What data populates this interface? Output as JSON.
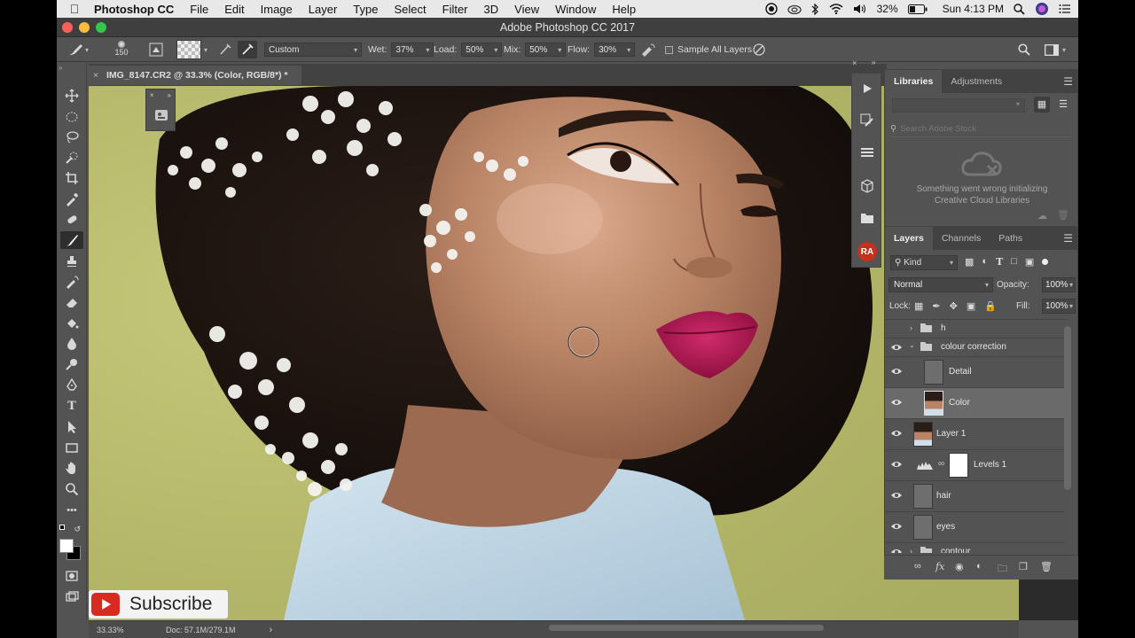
{
  "menubar": {
    "app_name": "Photoshop CC",
    "items": [
      "File",
      "Edit",
      "Image",
      "Layer",
      "Type",
      "Select",
      "Filter",
      "3D",
      "View",
      "Window",
      "Help"
    ],
    "battery": "32%",
    "clock": "Sun 4:13 PM"
  },
  "window_title": "Adobe Photoshop CC 2017",
  "options": {
    "brush_size": "150",
    "preset": "Custom",
    "wet_label": "Wet:",
    "wet_value": "37%",
    "load_label": "Load:",
    "load_value": "50%",
    "mix_label": "Mix:",
    "mix_value": "50%",
    "flow_label": "Flow:",
    "flow_value": "30%",
    "sample_all_layers": "Sample All Layers"
  },
  "document": {
    "tab_title": "IMG_8147.CR2 @ 33.3% (Color, RGB/8*) *",
    "zoom": "33.33%",
    "doc_size": "Doc: 57.1M/279.1M"
  },
  "overlay": {
    "subscribe": "Subscribe"
  },
  "libraries": {
    "tabs": [
      "Libraries",
      "Adjustments"
    ],
    "search_placeholder": "Search Adobe Stock",
    "error_line1": "Something went wrong initializing",
    "error_line2": "Creative Cloud Libraries"
  },
  "layers_panel": {
    "tabs": [
      "Layers",
      "Channels",
      "Paths"
    ],
    "filter_kind": "Kind",
    "blend_mode": "Normal",
    "opacity_label": "Opacity:",
    "opacity_value": "100%",
    "lock_label": "Lock:",
    "fill_label": "Fill:",
    "fill_value": "100%",
    "layers": [
      {
        "name": "h",
        "type": "group",
        "visible": false
      },
      {
        "name": "colour correction",
        "type": "group-open",
        "visible": true
      },
      {
        "name": "Detail",
        "type": "layer",
        "visible": true
      },
      {
        "name": "Color",
        "type": "layer",
        "visible": true,
        "selected": true
      },
      {
        "name": "Layer 1",
        "type": "layer",
        "visible": true
      },
      {
        "name": "Levels 1",
        "type": "adjustment",
        "visible": true
      },
      {
        "name": "hair",
        "type": "layer",
        "visible": true
      },
      {
        "name": "eyes",
        "type": "layer",
        "visible": true
      },
      {
        "name": "contour",
        "type": "group",
        "visible": true
      }
    ]
  },
  "icon_badge": "RA",
  "colors": {
    "ui_bg": "#535353",
    "canvas_bg": "#b3b96a",
    "lip": "#b0174f",
    "skin": "#b07a5c"
  }
}
